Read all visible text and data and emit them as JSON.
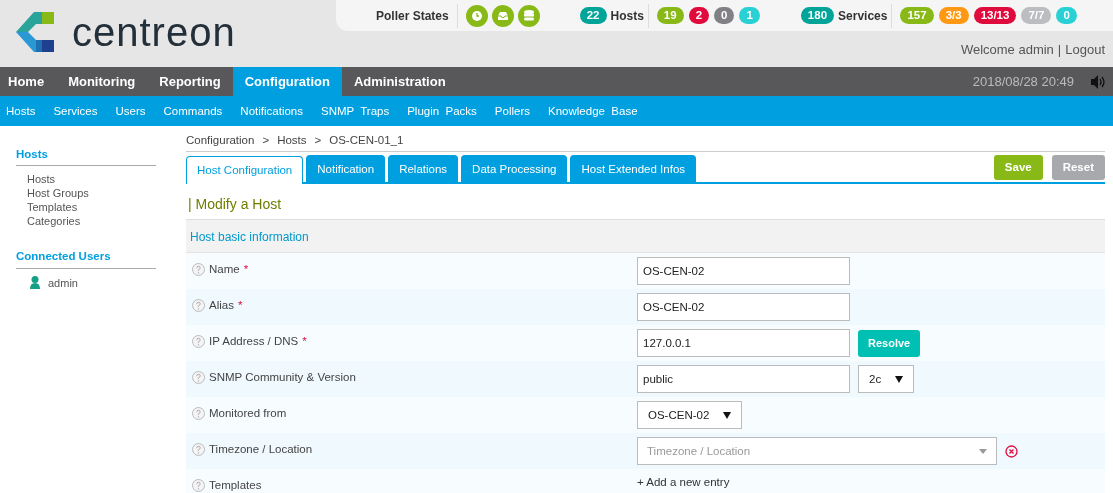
{
  "logo": {
    "text": "centreon"
  },
  "poller_states": {
    "label": "Poller States"
  },
  "hosts_summary": {
    "total": "22",
    "label": "Hosts",
    "counts": [
      {
        "value": "19",
        "color": "#88b917"
      },
      {
        "value": "2",
        "color": "#e00b3d"
      },
      {
        "value": "0",
        "color": "#818185"
      },
      {
        "value": "1",
        "color": "#2ad1d4"
      }
    ]
  },
  "services_summary": {
    "total": "180",
    "label": "Services",
    "counts": [
      {
        "value": "157",
        "color": "#88b917"
      },
      {
        "value": "3/3",
        "color": "#ff9913"
      },
      {
        "value": "13/13",
        "color": "#e00b3d"
      },
      {
        "value": "7/7",
        "color": "#bcbdc0"
      },
      {
        "value": "0",
        "color": "#2ad1d4"
      }
    ]
  },
  "user_links": {
    "welcome": "Welcome admin",
    "separator": "|",
    "logout": "Logout"
  },
  "main_menu": [
    {
      "label": "Home",
      "selected": false
    },
    {
      "label": "Monitoring",
      "selected": false
    },
    {
      "label": "Reporting",
      "selected": false
    },
    {
      "label": "Configuration",
      "selected": true
    },
    {
      "label": "Administration",
      "selected": false
    }
  ],
  "datetime": "2018/08/28 20:49",
  "sub_menu": [
    "Hosts",
    "Services",
    "Users",
    "Commands",
    "Notifications",
    "SNMP  Traps",
    "Plugin  Packs",
    "Pollers",
    "Knowledge  Base"
  ],
  "sidebar": {
    "title": "Hosts",
    "items": [
      "Hosts",
      "Host Groups",
      "Templates",
      "Categories"
    ],
    "users_title": "Connected Users",
    "users": [
      "admin"
    ]
  },
  "breadcrumb": {
    "separator": ">",
    "items": [
      "Configuration",
      "Hosts",
      "OS-CEN-01_1"
    ]
  },
  "tabs": [
    {
      "label": "Host Configuration",
      "selected": true
    },
    {
      "label": "Notification",
      "selected": false
    },
    {
      "label": "Relations",
      "selected": false
    },
    {
      "label": "Data Processing",
      "selected": false
    },
    {
      "label": "Host Extended Infos",
      "selected": false
    }
  ],
  "actions": [
    {
      "label": "Save",
      "kind": "primary"
    },
    {
      "label": "Reset",
      "kind": "secondary"
    }
  ],
  "form": {
    "title": "| Modify a Host",
    "section": "Host basic information",
    "rows": [
      {
        "label": "Name",
        "required_mark": "*",
        "kind": "text",
        "value": "OS-CEN-02"
      },
      {
        "label": "Alias",
        "required_mark": "*",
        "kind": "text",
        "value": "OS-CEN-02"
      },
      {
        "label": "IP Address / DNS",
        "required_mark": "*",
        "kind": "text_button",
        "value": "127.0.0.1",
        "button": "Resolve"
      },
      {
        "label": "SNMP Community & Version",
        "kind": "text_select",
        "value": "public",
        "select": "2c"
      },
      {
        "label": "Monitored from",
        "kind": "select",
        "select": "OS-CEN-02"
      },
      {
        "label": "Timezone / Location",
        "kind": "select2",
        "placeholder": "Timezone / Location"
      },
      {
        "label": "Templates",
        "kind": "link",
        "link": "+ Add a new entry"
      }
    ]
  }
}
